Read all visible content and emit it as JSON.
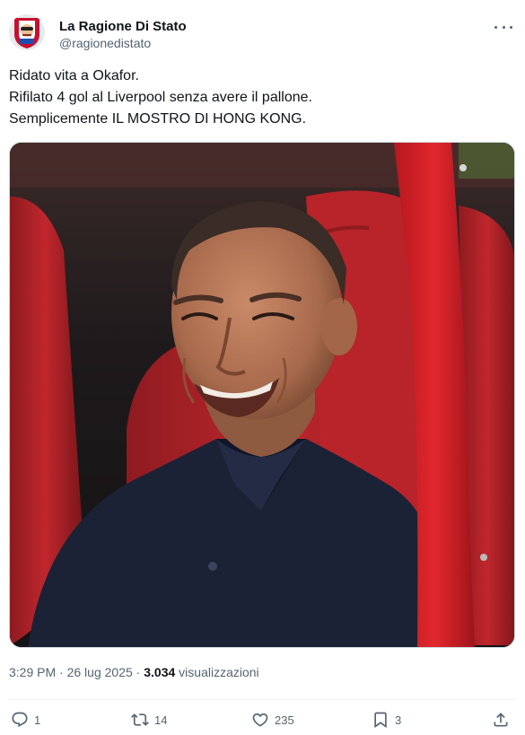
{
  "author": {
    "display_name": "La Ragione Di Stato",
    "handle": "@ragionedistato"
  },
  "tweet": {
    "lines": [
      "Ridato vita a Okafor.",
      "Rifilato 4 gol al Liverpool senza avere il pallone.",
      "Semplicemente IL MOSTRO DI HONG KONG."
    ]
  },
  "meta": {
    "time": "3:29 PM",
    "separator": "·",
    "date": "26 lug 2025",
    "views_count": "3.034",
    "views_label": "visualizzazioni"
  },
  "actions": {
    "reply_count": "1",
    "retweet_count": "14",
    "like_count": "235",
    "bookmark_count": "3"
  },
  "colors": {
    "text": "#0f1419",
    "secondary": "#536471",
    "divider": "#eff3f4",
    "seat_red": "#c0272d"
  },
  "icons": [
    "more-icon",
    "reply-icon",
    "retweet-icon",
    "like-icon",
    "bookmark-icon",
    "share-icon"
  ]
}
